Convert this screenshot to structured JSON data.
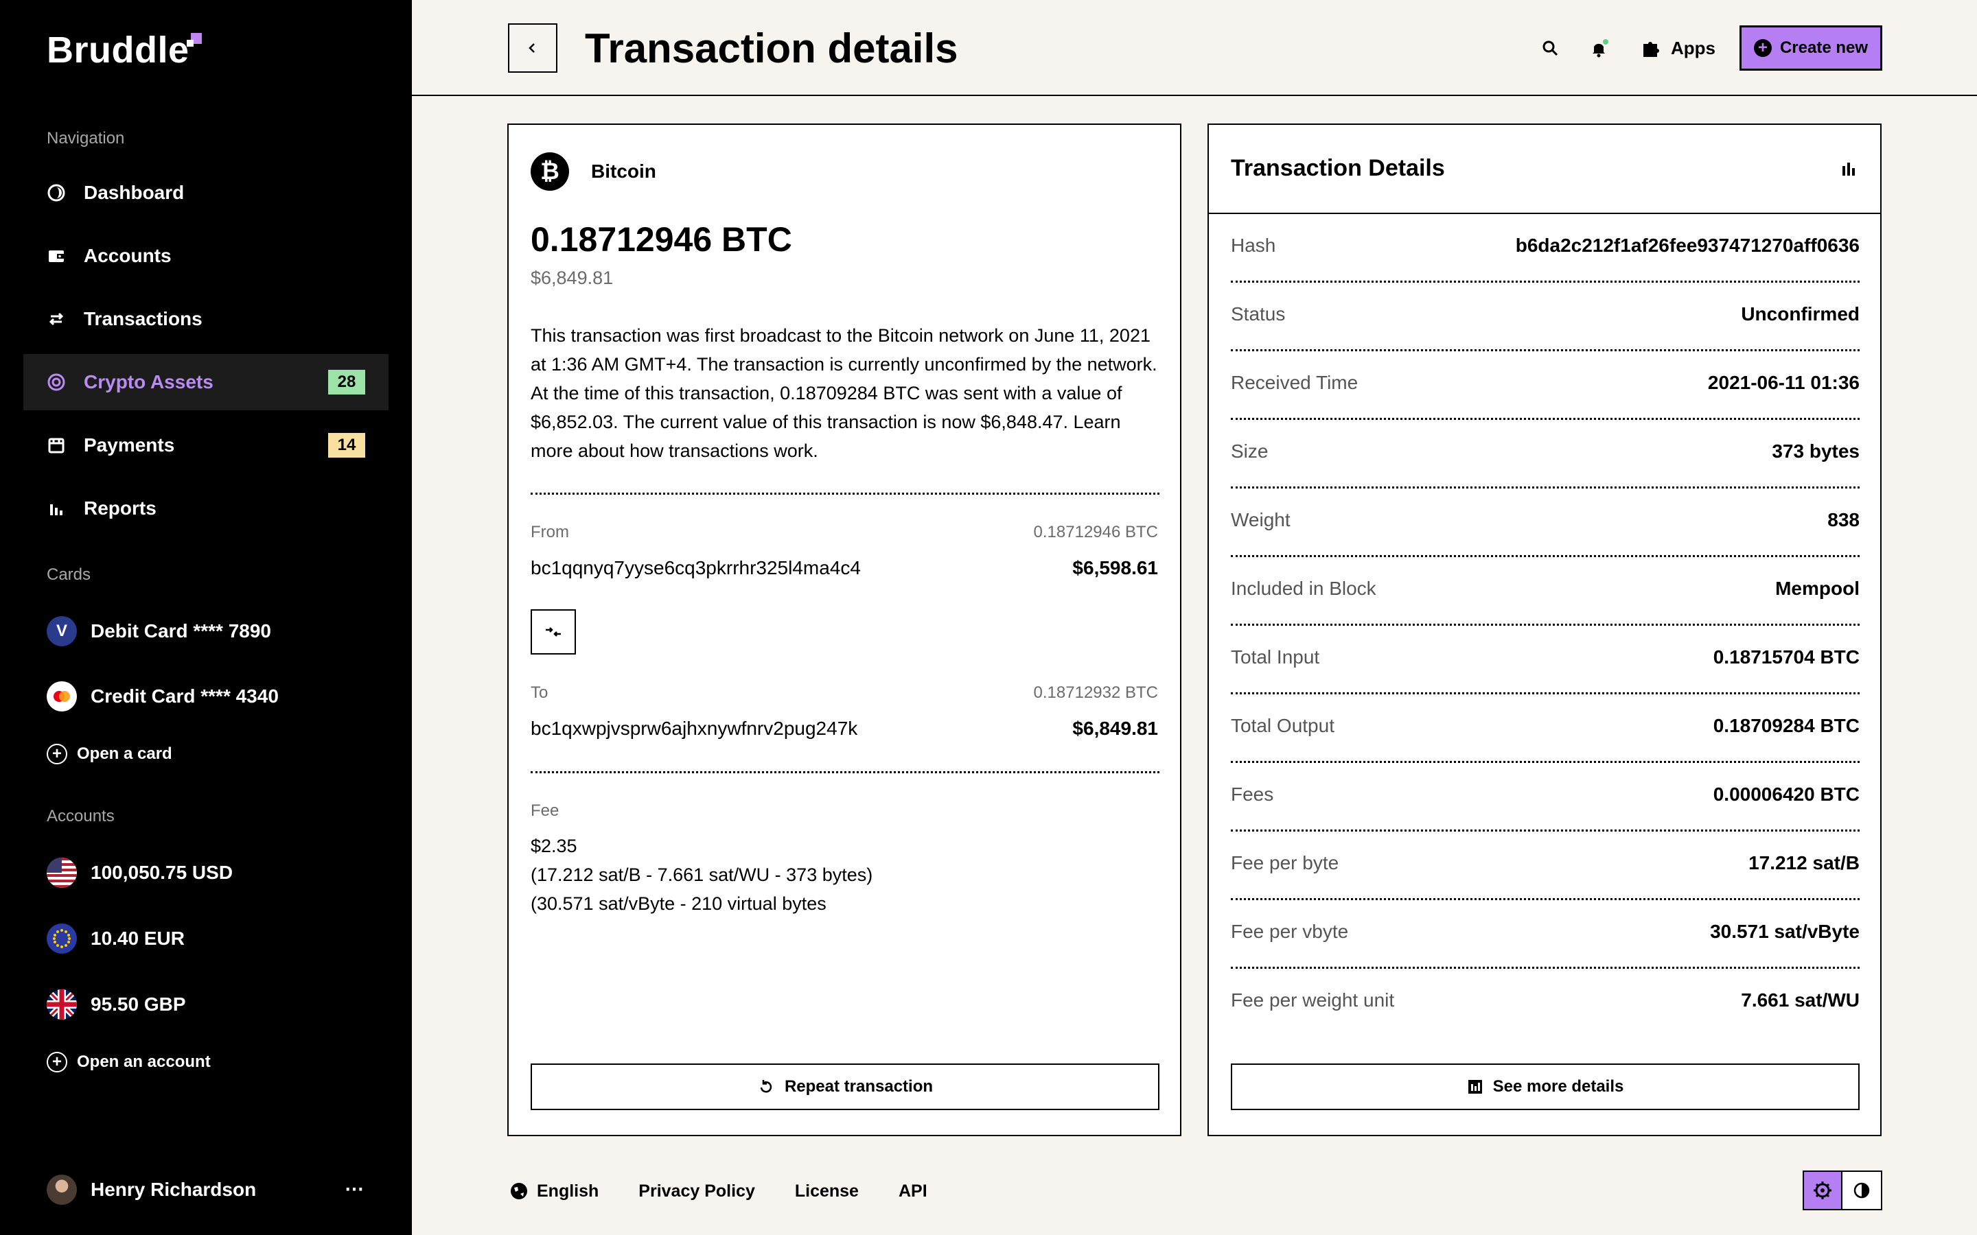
{
  "brand": {
    "name": "Bruddle"
  },
  "sidebar": {
    "nav_label": "Navigation",
    "nav": [
      {
        "label": "Dashboard",
        "icon": "dashboard-icon"
      },
      {
        "label": "Accounts",
        "icon": "wallet-icon"
      },
      {
        "label": "Transactions",
        "icon": "transfer-icon"
      },
      {
        "label": "Crypto Assets",
        "icon": "crypto-icon",
        "badge": "28",
        "badge_color": "#9be3a6",
        "active": true
      },
      {
        "label": "Payments",
        "icon": "payments-icon",
        "badge": "14",
        "badge_color": "#f9e0a0"
      },
      {
        "label": "Reports",
        "icon": "bar-chart-icon"
      }
    ],
    "cards_label": "Cards",
    "cards": [
      {
        "label": "Debit Card **** 7890",
        "icon": "visa-icon",
        "glyph": "V"
      },
      {
        "label": "Credit Card **** 4340",
        "icon": "mastercard-icon"
      }
    ],
    "open_card": "Open a card",
    "accounts_label": "Accounts",
    "accounts": [
      {
        "label": "100,050.75 USD",
        "icon": "us-flag-icon"
      },
      {
        "label": "10.40 EUR",
        "icon": "eu-flag-icon"
      },
      {
        "label": "95.50 GBP",
        "icon": "uk-flag-icon"
      }
    ],
    "open_account": "Open an account",
    "user": {
      "name": "Henry Richardson",
      "more": "⋯"
    }
  },
  "header": {
    "title": "Transaction details",
    "apps_label": "Apps",
    "create_label": "Create new",
    "accent": "#b57ef2"
  },
  "transaction": {
    "coin": "Bitcoin",
    "amount": "0.18712946 BTC",
    "fiat": "$6,849.81",
    "description": "This transaction was first broadcast to the Bitcoin network on June 11, 2021 at 1:36 AM GMT+4.  The transaction is currently unconfirmed by the network.  At the time of this transaction, 0.18709284 BTC was sent with a value of $6,852.03. The current value of this transaction is now $6,848.47. Learn more about how transactions work.",
    "from": {
      "label": "From",
      "btc": "0.18712946 BTC",
      "address": "bc1qqnyq7yyse6cq3pkrrhr325l4ma4c4",
      "usd": "$6,598.61"
    },
    "to": {
      "label": "To",
      "btc": "0.18712932 BTC",
      "address": "bc1qxwpjvsprw6ajhxnywfnrv2pug247k",
      "usd": "$6,849.81"
    },
    "fee": {
      "label": "Fee",
      "lines": [
        "$2.35",
        "(17.212 sat/B - 7.661 sat/WU - 373 bytes)",
        "(30.571 sat/vByte - 210 virtual bytes"
      ]
    },
    "repeat_label": "Repeat transaction"
  },
  "details": {
    "title": "Transaction Details",
    "rows": [
      {
        "k": "Hash",
        "v": "b6da2c212f1af26fee937471270aff0636"
      },
      {
        "k": "Status",
        "v": "Unconfirmed"
      },
      {
        "k": "Received Time",
        "v": "2021-06-11 01:36"
      },
      {
        "k": "Size",
        "v": "373 bytes"
      },
      {
        "k": "Weight",
        "v": "838"
      },
      {
        "k": "Included in Block",
        "v": "Mempool"
      },
      {
        "k": "Total Input",
        "v": "0.18715704 BTC"
      },
      {
        "k": "Total Output",
        "v": "0.18709284 BTC"
      },
      {
        "k": "Fees",
        "v": "0.00006420 BTC"
      },
      {
        "k": "Fee per byte",
        "v": "17.212 sat/B"
      },
      {
        "k": "Fee per vbyte",
        "v": "30.571 sat/vByte"
      },
      {
        "k": "Fee per weight unit",
        "v": "7.661 sat/WU"
      }
    ],
    "more_label": "See more details"
  },
  "footer": {
    "language": "English",
    "links": [
      "Privacy Policy",
      "License",
      "API"
    ]
  }
}
